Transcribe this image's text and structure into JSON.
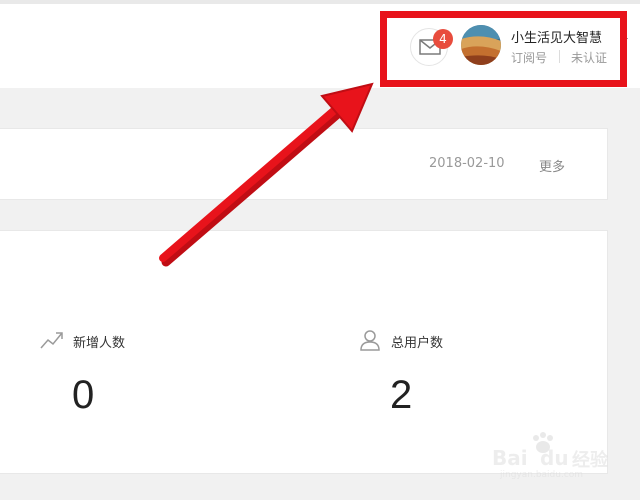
{
  "header": {
    "mail_badge": "4",
    "account_name": "小生活见大智慧",
    "account_type": "订阅号",
    "verify_status": "未认证",
    "icons": [
      "mail-icon",
      "avatar",
      "chevron-down-icon"
    ]
  },
  "notice": {
    "date": "2018-02-10",
    "more_label": "更多"
  },
  "stats": {
    "items": [
      {
        "label": "新增人数",
        "value": "0",
        "icon": "trend-up-icon"
      },
      {
        "label": "总用户数",
        "value": "2",
        "icon": "user-icon"
      }
    ]
  },
  "annotation": {
    "color": "#e8131b"
  },
  "watermark": {
    "brand": "Bai",
    "brand_suffix": "du",
    "product": "经验",
    "url": "jingyan.baidu.com"
  }
}
